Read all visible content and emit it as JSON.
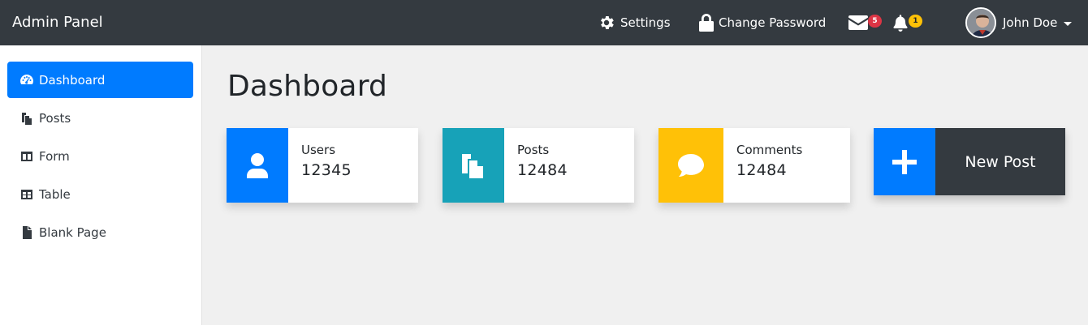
{
  "navbar": {
    "brand": "Admin Panel",
    "settings_label": "Settings",
    "change_password_label": "Change Password",
    "messages_count": "5",
    "notifications_count": "1",
    "user_name": "John Doe",
    "bg_color": "#343a40"
  },
  "sidebar": {
    "items": [
      {
        "label": "Dashboard",
        "icon": "tachometer-icon",
        "active": true
      },
      {
        "label": "Posts",
        "icon": "copy-icon",
        "active": false
      },
      {
        "label": "Form",
        "icon": "columns-icon",
        "active": false
      },
      {
        "label": "Table",
        "icon": "table-icon",
        "active": false
      },
      {
        "label": "Blank Page",
        "icon": "file-icon",
        "active": false
      }
    ],
    "active_color": "#007bff"
  },
  "main": {
    "title": "Dashboard",
    "cards": [
      {
        "label": "Users",
        "value": "12345",
        "icon": "user-icon",
        "color": "#007bff"
      },
      {
        "label": "Posts",
        "value": "12484",
        "icon": "copy-icon",
        "color": "#17a2b8"
      },
      {
        "label": "Comments",
        "value": "12484",
        "icon": "comment-icon",
        "color": "#ffc107"
      }
    ],
    "new_post": {
      "label": "New Post",
      "icon": "plus-icon",
      "plus_color": "#007bff",
      "text_bg": "#343a40"
    }
  }
}
